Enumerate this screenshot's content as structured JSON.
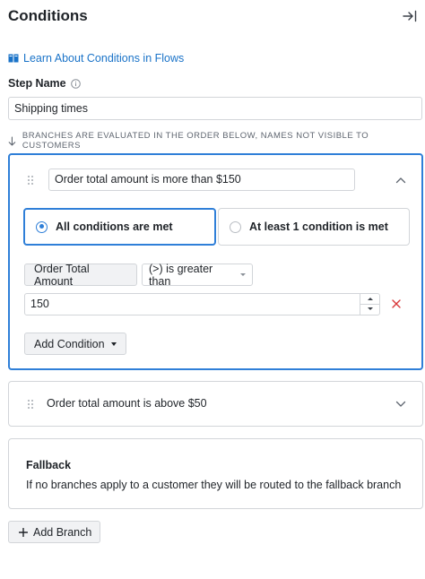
{
  "header": {
    "title": "Conditions",
    "collapse_icon": "collapse-right-icon"
  },
  "learn_link": {
    "label": "Learn About Conditions in Flows",
    "icon": "book-icon"
  },
  "step_name": {
    "label": "Step Name",
    "value": "Shipping times",
    "info_icon": "info-icon"
  },
  "order_note": "Branches are evaluated in the order below, names not visible to customers",
  "branches": [
    {
      "name": "Order total amount is more than $150",
      "expanded": true,
      "match_options": [
        {
          "label": "All conditions are met",
          "selected": true
        },
        {
          "label": "At least 1 condition is met",
          "selected": false
        }
      ],
      "condition": {
        "field": "Order Total Amount",
        "operator": "(>) is greater than",
        "value": "150"
      },
      "add_condition_label": "Add Condition"
    },
    {
      "name": "Order total amount is above $50",
      "expanded": false
    }
  ],
  "fallback": {
    "title": "Fallback",
    "description": "If no branches apply to a customer they will be routed to the fallback branch"
  },
  "add_branch_label": "Add Branch",
  "colors": {
    "accent": "#2f7fd8",
    "link": "#1a73c8",
    "danger": "#d9383a",
    "border": "#d2d5d9"
  }
}
